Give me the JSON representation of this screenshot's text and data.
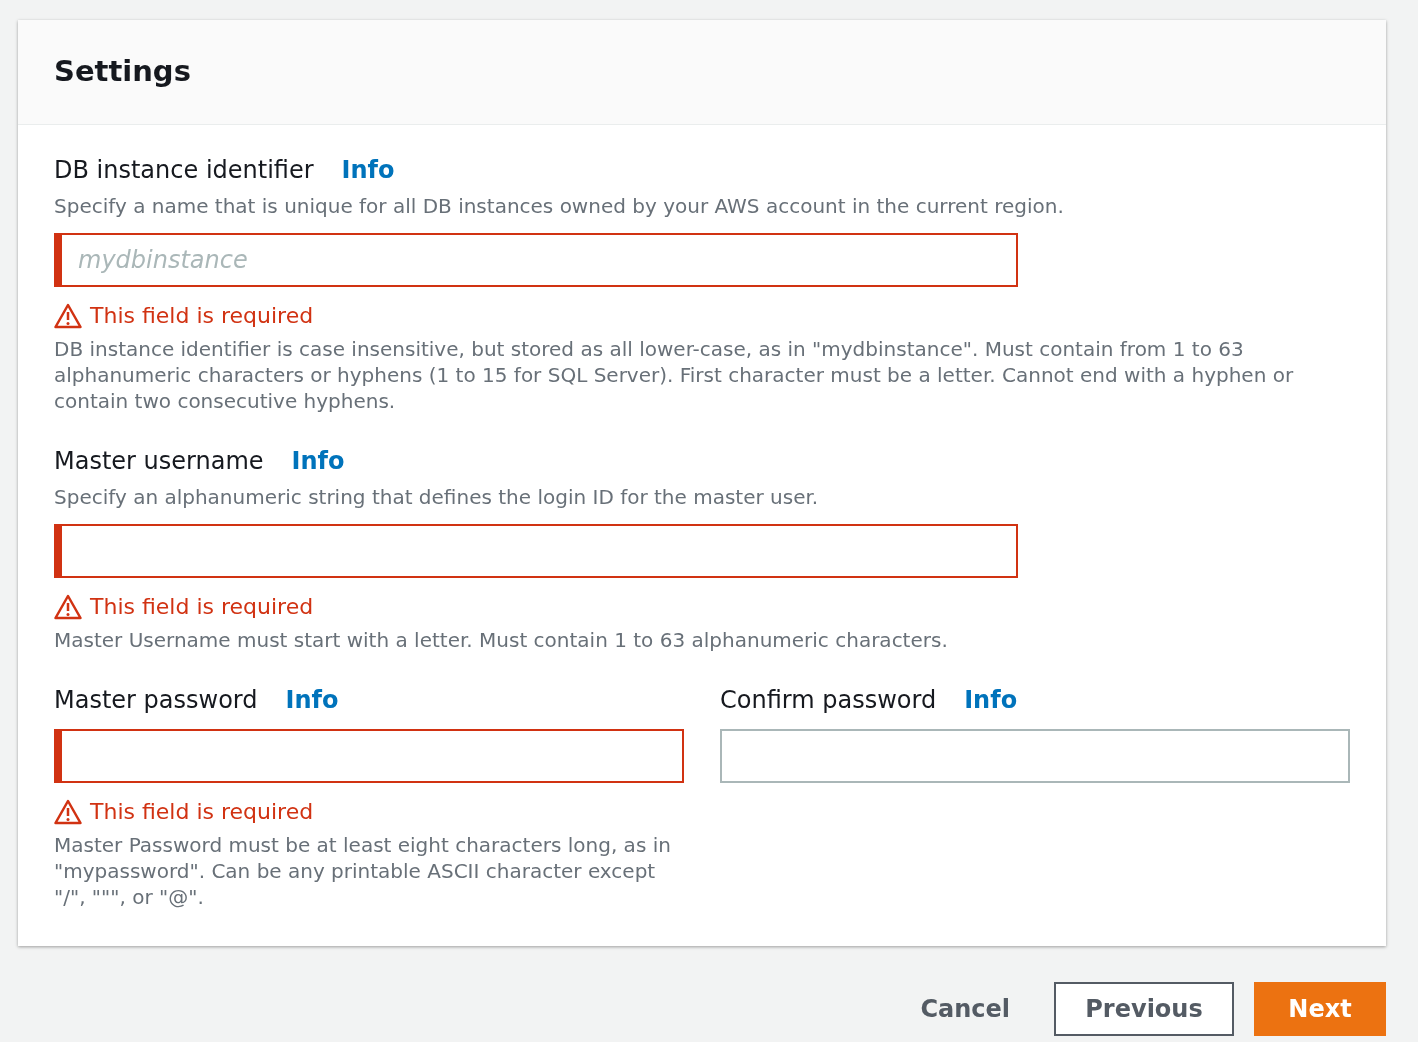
{
  "panel": {
    "title": "Settings"
  },
  "rows": [
    [
      {
        "label": "DB instance identifier",
        "info": "Info",
        "description": "Specify a name that is unique for all DB instances owned by your AWS account in the current region.",
        "placeholder": "mydbinstance",
        "error": true,
        "error_text": "This field is required",
        "hint": "DB instance identifier is case insensitive, but stored as all lower-case, as in \"mydbinstance\". Must contain from 1 to 63 alphanumeric characters or hyphens (1 to 15 for SQL Server). First character must be a letter. Cannot end with a hyphen or contain two consecutive hyphens."
      }
    ],
    [
      {
        "label": "Master username",
        "info": "Info",
        "description": "Specify an alphanumeric string that defines the login ID for the master user.",
        "error": true,
        "error_text": "This field is required",
        "hint": "Master Username must start with a letter. Must contain 1 to 63 alphanumeric characters."
      }
    ],
    [
      {
        "label": "Master password",
        "info": "Info",
        "error": true,
        "error_text": "This field is required",
        "hint": "Master Password must be at least eight characters long, as in \"mypassword\". Can be any printable ASCII character except \"/\", \"\"\", or \"@\"."
      },
      {
        "label": "Confirm password",
        "info": "Info",
        "error": false
      }
    ]
  ],
  "buttons": [
    {
      "label": "Cancel",
      "kind": "link"
    },
    {
      "label": "Previous",
      "kind": "secondary"
    },
    {
      "label": "Next",
      "kind": "primary"
    }
  ]
}
